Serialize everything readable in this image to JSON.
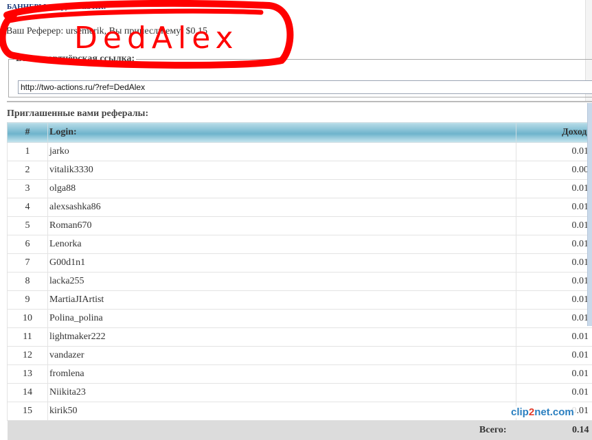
{
  "banner_link": "БАННЕРЫ С... руйте на ПК:",
  "referer_line": "Ваш Реферер: ursemerik, Вы принесли ему: $0.15",
  "annotation_text": "DedAlex",
  "partner_box": {
    "legend": "Ваша партнёрская ссылка:",
    "link_value": "http://two-actions.ru/?ref=DedAlex"
  },
  "referrals_title": "Приглашенные вами рефералы:",
  "table": {
    "headers": [
      "#",
      "Login:",
      "Доход $"
    ],
    "rows": [
      [
        "1",
        "jarko",
        "0.01"
      ],
      [
        "2",
        "vitalik3330",
        "0.00"
      ],
      [
        "3",
        "olga88",
        "0.01"
      ],
      [
        "4",
        "alexsashka86",
        "0.01"
      ],
      [
        "5",
        "Roman670",
        "0.01"
      ],
      [
        "6",
        "Lenorka",
        "0.01"
      ],
      [
        "7",
        "G00d1n1",
        "0.01"
      ],
      [
        "8",
        "lacka255",
        "0.01"
      ],
      [
        "9",
        "MartiaJIArtist",
        "0.01"
      ],
      [
        "10",
        "Polina_polina",
        "0.01"
      ],
      [
        "11",
        "lightmaker222",
        "0.01"
      ],
      [
        "12",
        "vandazer",
        "0.01"
      ],
      [
        "13",
        "fromlena",
        "0.01"
      ],
      [
        "14",
        "Niikita23",
        "0.01"
      ],
      [
        "15",
        "kirik50",
        "0.01"
      ]
    ],
    "total_label": "Всего:",
    "total_value": "0.14"
  },
  "watermark": {
    "part1": "clip",
    "part2": "2",
    "part3": "net.com"
  },
  "colors": {
    "header_gradient_mid": "#6eb4cc",
    "annotation": "#ff0000",
    "total_row": "#dcdcdc"
  }
}
